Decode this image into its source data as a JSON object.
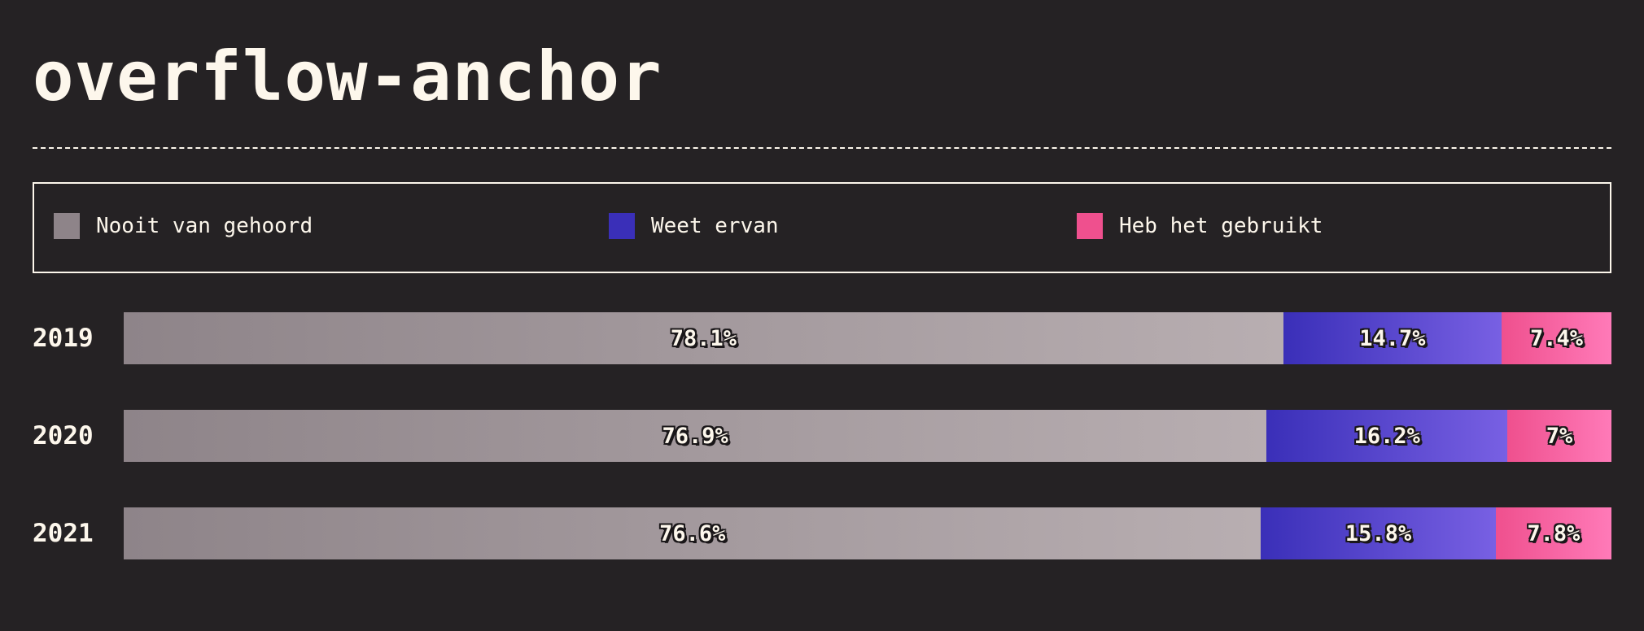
{
  "title": "overflow-anchor",
  "legend": [
    {
      "label": "Nooit van gehoord",
      "color": "#8e8489"
    },
    {
      "label": "Weet ervan",
      "color": "#3a2fb8"
    },
    {
      "label": "Heb het gebruikt",
      "color": "#ef508e"
    }
  ],
  "chart_data": {
    "type": "bar",
    "orientation": "horizontal",
    "stacked": true,
    "normalized": true,
    "title": "overflow-anchor",
    "categories": [
      "2019",
      "2020",
      "2021"
    ],
    "series": [
      {
        "name": "Nooit van gehoord",
        "values": [
          78.1,
          76.9,
          76.6
        ],
        "labels": [
          "78.1%",
          "76.9%",
          "76.6%"
        ],
        "color_start": "#8e8489",
        "color_end": "#b8aeb1"
      },
      {
        "name": "Weet ervan",
        "values": [
          14.7,
          16.2,
          15.8
        ],
        "labels": [
          "14.7%",
          "16.2%",
          "15.8%"
        ],
        "color_start": "#3a2fb8",
        "color_end": "#7860e3"
      },
      {
        "name": "Heb het gebruikt",
        "values": [
          7.4,
          7,
          7.8
        ],
        "labels": [
          "7.4%",
          "7%",
          "7.8%"
        ],
        "color_start": "#ef508e",
        "color_end": "#ff7ab8"
      }
    ],
    "legend_position": "top",
    "grid": false
  }
}
